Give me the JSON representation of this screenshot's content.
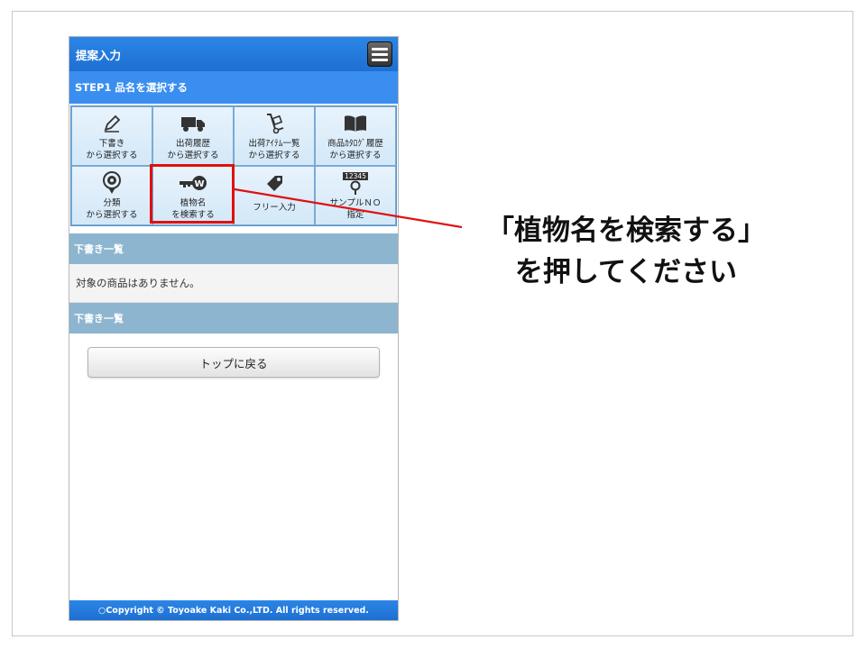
{
  "app": {
    "title": "提案入力",
    "step_label": "STEP1 品名を選択する"
  },
  "tiles": [
    {
      "label": "下書き\nから選択する",
      "icon": "pencil-icon"
    },
    {
      "label": "出荷履歴\nから選択する",
      "icon": "truck-icon"
    },
    {
      "label": "出荷ｱｲﾃﾑ一覧\nから選択する",
      "icon": "hand-truck-icon"
    },
    {
      "label": "商品ｶﾀﾛｸﾞ履歴\nから選択する",
      "icon": "book-icon"
    },
    {
      "label": "分類\nから選択する",
      "icon": "flower-pin-icon"
    },
    {
      "label": "植物名\nを検索する",
      "icon": "key-icon"
    },
    {
      "label": "フリー入力",
      "icon": "tag-icon"
    },
    {
      "label": "サンプルＮＯ\n指定",
      "icon": "number-pin-icon",
      "badge": "12345"
    }
  ],
  "drafts_header": "下書き一覧",
  "empty_message": "対象の商品はありません。",
  "drafts_header_2": "下書き一覧",
  "back_button": "トップに戻る",
  "footer": "○Copyright © Toyoake Kaki Co.,LTD. All rights reserved.",
  "callout": "「植物名を検索する」\nを押してください",
  "colors": {
    "header": "#1e6fd1",
    "highlight": "#e01010",
    "section": "#8db5cf"
  }
}
